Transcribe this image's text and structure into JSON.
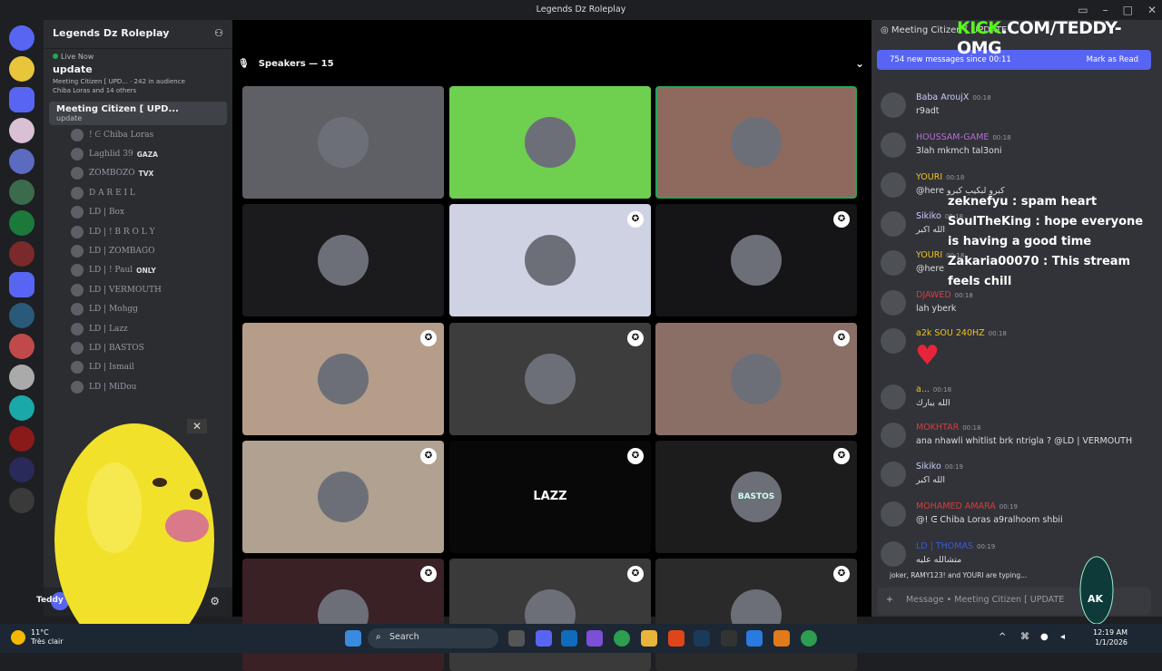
{
  "window": {
    "title": "Legends Dz Roleplay"
  },
  "server": {
    "name": "Legends Dz Roleplay",
    "live_now": "Live Now",
    "live_title": "update",
    "stage_info": "Meeting Citizen [ UPD...",
    "audience": "242 in audience",
    "others": "Chiba Loras and 14 others"
  },
  "active_channel": {
    "name": "Meeting Citizen [ UPD...",
    "sub": "update"
  },
  "members": [
    {
      "name": "! ᕮ Chiba Loras",
      "tag": ""
    },
    {
      "name": "Laghlid 39",
      "tag": "GAZA"
    },
    {
      "name": "ZOMBOZO",
      "tag": "TVX"
    },
    {
      "name": "D A R E I L",
      "tag": ""
    },
    {
      "name": "LD | Box",
      "tag": ""
    },
    {
      "name": "LD | ! B R O L Y",
      "tag": ""
    },
    {
      "name": "LD | ZOMBAGO",
      "tag": ""
    },
    {
      "name": "LD | ! Paul",
      "tag": "ONLY"
    },
    {
      "name": "LD | VERMOUTH",
      "tag": ""
    },
    {
      "name": "LD | Mohgg",
      "tag": ""
    },
    {
      "name": "LD | Lazz",
      "tag": ""
    },
    {
      "name": "LD | BASTOS",
      "tag": ""
    },
    {
      "name": "LD | Ismail",
      "tag": ""
    },
    {
      "name": "LD | MiDou",
      "tag": ""
    }
  ],
  "user": {
    "name": "Teddy"
  },
  "stage": {
    "speakers_label": "Speakers — 15"
  },
  "tiles": [
    {
      "bg": "#5f6065",
      "badge": false
    },
    {
      "bg": "#6fcf4f",
      "badge": false
    },
    {
      "bg": "#8e6a5e",
      "badge": false
    },
    {
      "bg": "#1b1b1d",
      "badge": false
    },
    {
      "bg": "#cfd2e2",
      "badge": true
    },
    {
      "bg": "#151517",
      "badge": true
    },
    {
      "bg": "#b59d8a",
      "badge": true
    },
    {
      "bg": "#3d3d3d",
      "badge": true
    },
    {
      "bg": "#8a6f66",
      "badge": true
    },
    {
      "bg": "#b0a191",
      "badge": true
    },
    {
      "bg": "#080808",
      "badge": true
    },
    {
      "bg": "#1c1c1c",
      "badge": true
    },
    {
      "bg": "#3a2126",
      "badge": true
    },
    {
      "bg": "#3a3a3a",
      "badge": true
    },
    {
      "bg": "#2a2a2a",
      "badge": true
    }
  ],
  "tile_labels": {
    "lazz": "LAZZ",
    "bastos": "BASTOS"
  },
  "chat": {
    "header": "Meeting Citizen [ UPDATE",
    "new_messages": "754 new messages since 00:11",
    "mark_read": "Mark as Read",
    "messages": [
      {
        "name": "Baba AroujX",
        "color": "#c9cdfb",
        "time": "00:18",
        "text": "r9adt"
      },
      {
        "name": "HOUSSAM-GAME",
        "color": "#b86bd6",
        "time": "00:18",
        "text": "3lah mkmch tal3oni"
      },
      {
        "name": "YOURI",
        "color": "#f0c419",
        "time": "00:18",
        "text": "@here كبرو لبكيب كبرو"
      },
      {
        "name": "Sikiko",
        "color": "#c9cdfb",
        "time": "00:18",
        "text": "الله اكبر"
      },
      {
        "name": "YOURI",
        "color": "#f0c419",
        "time": "00:18",
        "text": "@here"
      },
      {
        "name": "DJAWED",
        "color": "#d83c3e",
        "time": "00:18",
        "text": "lah yberk"
      },
      {
        "name": "a2k SOU 240HZ",
        "color": "#f0c419",
        "time": "00:18",
        "text": ""
      },
      {
        "name": "a...",
        "color": "#f0c419",
        "time": "00:18",
        "text": "الله يبارك"
      },
      {
        "name": "MOKHTAR",
        "color": "#d83c3e",
        "time": "00:18",
        "text": "ana nhawli whitlist brk ntrigla ? @LD | VERMOUTH"
      },
      {
        "name": "Sikiko",
        "color": "#c9cdfb",
        "time": "00:19",
        "text": "الله اكبر"
      },
      {
        "name": "MOHAMED AMARA",
        "color": "#d83c3e",
        "time": "00:19",
        "text": "@! ᕮ Chiba Loras a9ralhoom shbii"
      },
      {
        "name": "LD | THOMAS",
        "color": "#3b5bdb",
        "time": "00:19",
        "text": "متشالله عليه"
      }
    ],
    "typing": "joker, RAMY123! and YOURI are typing...",
    "input_placeholder": "Message • Meeting Citizen [ UPDATE"
  },
  "overlay": {
    "kick_prefix": "KICK",
    "kick_suffix": ".COM/TEDDY-OMG",
    "lines": [
      "zeknefyu : spam heart",
      "SoulTheKing : hope everyone is having a good time",
      "Zakaria00070 : This stream feels chill"
    ]
  },
  "taskbar": {
    "weather_temp": "11°C",
    "weather_desc": "Très clair",
    "search": "Search",
    "time": "12:19 AM",
    "date": "1/1/2026"
  }
}
